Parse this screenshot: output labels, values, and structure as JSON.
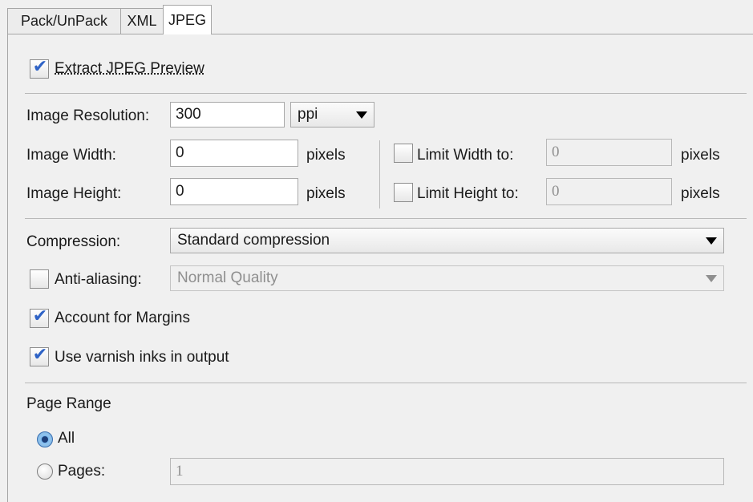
{
  "tabs": [
    {
      "label": "Pack/UnPack"
    },
    {
      "label": "XML"
    },
    {
      "label": "JPEG"
    }
  ],
  "extract_preview": {
    "label": "Extract JPEG Preview",
    "checked": true
  },
  "resolution": {
    "label": "Image Resolution:",
    "value": "300",
    "unit": "ppi"
  },
  "width": {
    "label": "Image Width:",
    "value": "0",
    "unit": "pixels"
  },
  "height": {
    "label": "Image Height:",
    "value": "0",
    "unit": "pixels"
  },
  "limit_width": {
    "label": "Limit Width to:",
    "value": "0",
    "unit": "pixels",
    "checked": false
  },
  "limit_height": {
    "label": "Limit Height to:",
    "value": "0",
    "unit": "pixels",
    "checked": false
  },
  "compression": {
    "label": "Compression:",
    "value": "Standard compression"
  },
  "anti_aliasing": {
    "label": "Anti-aliasing:",
    "value": "Normal Quality",
    "checked": false
  },
  "margins": {
    "label": "Account for Margins",
    "checked": true
  },
  "varnish": {
    "label": "Use varnish inks in output",
    "checked": true
  },
  "page_range": {
    "title": "Page Range",
    "all_label": "All",
    "pages_label": "Pages:",
    "pages_value": "1",
    "selected": "All"
  },
  "check_glyph": "✔",
  "colors": {
    "check": "#2f63c6",
    "radio_selected": "#1d3f7a"
  }
}
